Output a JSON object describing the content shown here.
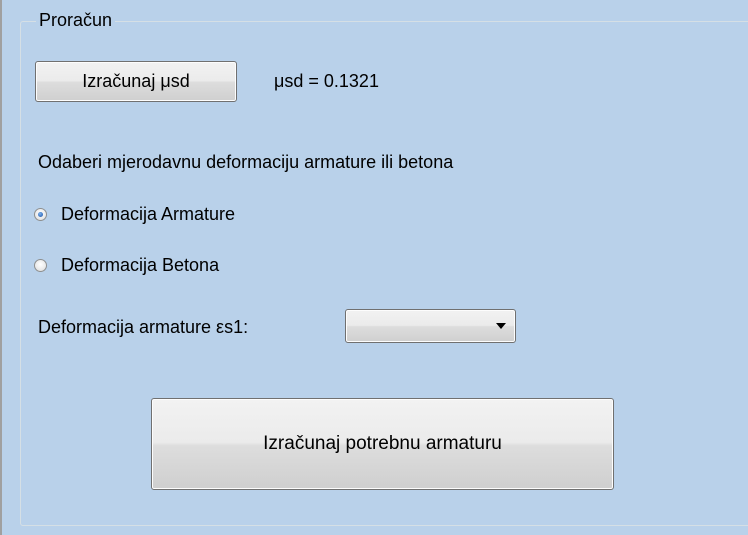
{
  "group": {
    "title": "Proračun"
  },
  "calc_musd_button": {
    "label": "Izračunaj μsd"
  },
  "musd_result": {
    "text": "μsd = 0.1321"
  },
  "instruction": {
    "text": "Odaberi mjerodavnu deformaciju armature ili betona"
  },
  "radios": [
    {
      "label": "Deformacija Armature",
      "checked": true
    },
    {
      "label": "Deformacija Betona",
      "checked": false
    }
  ],
  "deformation_select": {
    "label": "Deformacija armature εs1:",
    "selected_value": ""
  },
  "calc_reinforcement_button": {
    "label": "Izračunaj potrebnu armaturu"
  }
}
